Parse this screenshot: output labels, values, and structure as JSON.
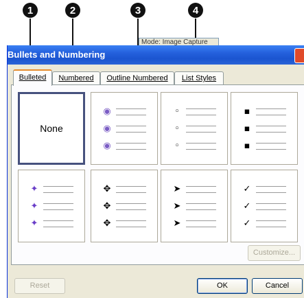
{
  "callouts": [
    "1",
    "2",
    "3",
    "4"
  ],
  "mode_popup": "Mode: Image Capture",
  "dialog": {
    "title": "Bullets and Numbering",
    "close_icon": "×"
  },
  "tabs": [
    {
      "label": "Bulleted",
      "active": true
    },
    {
      "label": "Numbered",
      "active": false
    },
    {
      "label": "Outline Numbered",
      "active": false
    },
    {
      "label": "List Styles",
      "active": false
    }
  ],
  "gallery": {
    "none_label": "None",
    "bullets": [
      {
        "glyph": "◉",
        "name": "spiral-bullet",
        "color": "#7a5cc4"
      },
      {
        "glyph": "◦",
        "name": "small-circle-bullet",
        "color": "#000000"
      },
      {
        "glyph": "▪",
        "name": "small-square-bullet",
        "color": "#000000"
      },
      {
        "glyph": "✦",
        "name": "plus-star-bullet",
        "color": "#6a3ec8"
      },
      {
        "glyph": "✥",
        "name": "four-diamond-bullet",
        "color": "#000000"
      },
      {
        "glyph": "➤",
        "name": "arrowhead-bullet",
        "color": "#000000"
      },
      {
        "glyph": "✓",
        "name": "checkmark-bullet",
        "color": "#000000"
      }
    ]
  },
  "buttons": {
    "customize": "Customize...",
    "reset": "Reset",
    "ok": "OK",
    "cancel": "Cancel"
  }
}
